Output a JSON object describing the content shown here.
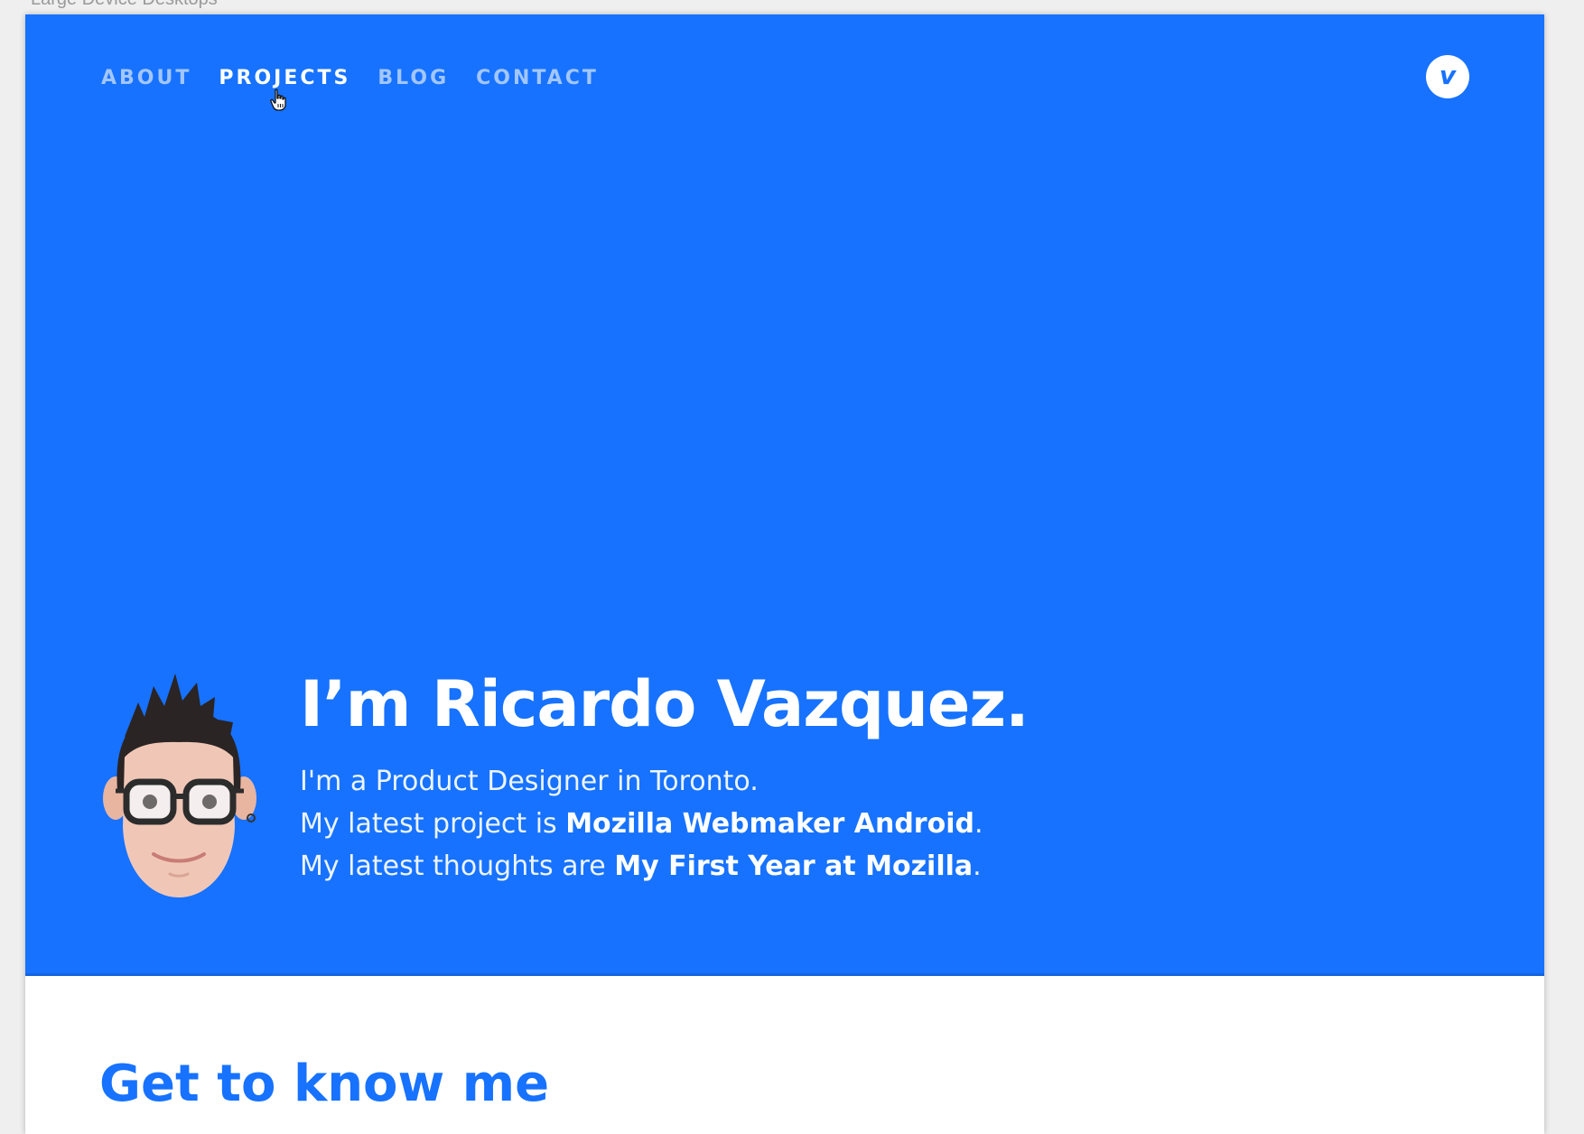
{
  "frame": {
    "caption": "Large Device Desktops"
  },
  "nav": {
    "items": [
      {
        "label": "ABOUT",
        "active": false
      },
      {
        "label": "PROJECTS",
        "active": true
      },
      {
        "label": "BLOG",
        "active": false
      },
      {
        "label": "CONTACT",
        "active": false
      }
    ]
  },
  "logo": {
    "letter": "v",
    "icon": "vimeo-logo-icon"
  },
  "hero": {
    "title": "I’m Ricardo Vazquez.",
    "line1": "I'm a Product Designer in Toronto.",
    "line2_prefix": "My latest project is ",
    "line2_link": "Mozilla Webmaker Android",
    "line2_suffix": ".",
    "line3_prefix": "My latest thoughts are ",
    "line3_link": "My First Year at Mozilla",
    "line3_suffix": "."
  },
  "section": {
    "title": "Get to know me"
  },
  "colors": {
    "primary": "#1772ff",
    "page_bg": "#efefef",
    "white": "#ffffff"
  }
}
